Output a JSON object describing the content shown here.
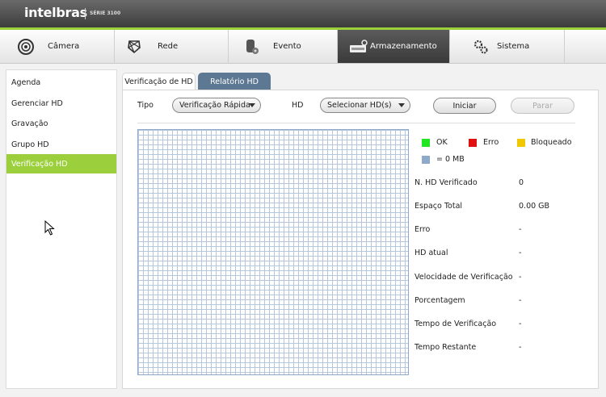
{
  "header": {
    "brand": "intelbras",
    "series": "SÉRIE 3100"
  },
  "main_tabs": [
    {
      "label": "Câmera",
      "icon": "camera-icon"
    },
    {
      "label": "Rede",
      "icon": "network-icon"
    },
    {
      "label": "Evento",
      "icon": "event-icon"
    },
    {
      "label": "Armazenamento",
      "icon": "storage-icon",
      "active": true
    },
    {
      "label": "Sistema",
      "icon": "system-gears-icon"
    }
  ],
  "sidebar": {
    "items": [
      {
        "label": "Agenda"
      },
      {
        "label": "Gerenciar HD"
      },
      {
        "label": "Gravação"
      },
      {
        "label": "Grupo HD"
      },
      {
        "label": "Verificação HD",
        "active": true
      }
    ]
  },
  "sub_tabs": [
    {
      "label": "Verificação de HD",
      "active": true
    },
    {
      "label": "Relatório HD"
    }
  ],
  "form": {
    "tipo_label": "Tipo",
    "tipo_value": "Verificação Rápida",
    "hd_label": "HD",
    "hd_value": "Selecionar HD(s)",
    "start_label": "Iniciar",
    "stop_label": "Parar"
  },
  "legend": {
    "ok": "OK",
    "error": "Erro",
    "blocked": "Bloqueado",
    "block_size": "= 0 MB",
    "colors": {
      "ok": "#22e622",
      "error": "#e01010",
      "blocked": "#f0c800",
      "block": "#8fa9c8"
    }
  },
  "info": [
    {
      "label": "N. HD Verificado",
      "value": "0"
    },
    {
      "label": "Espaço Total",
      "value": "0.00 GB"
    },
    {
      "label": "Erro",
      "value": "-"
    },
    {
      "label": "HD atual",
      "value": "-"
    },
    {
      "label": "Velocidade de Verificação",
      "value": "-"
    },
    {
      "label": "Porcentagem",
      "value": "-"
    },
    {
      "label": "Tempo de Verificação",
      "value": "-"
    },
    {
      "label": "Tempo Restante",
      "value": "-"
    }
  ],
  "colors": {
    "accent": "#9ccf3c",
    "subtab_inactive": "#5d7893"
  }
}
